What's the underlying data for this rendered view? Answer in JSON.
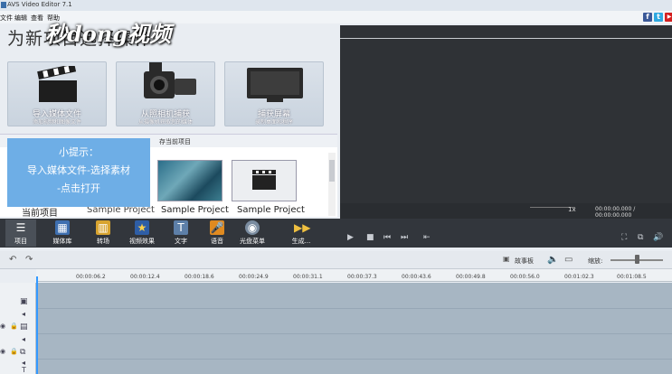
{
  "window": {
    "title": "AVS Video Editor 7.1"
  },
  "menu": [
    "文件",
    "编辑",
    "查看",
    "帮助"
  ],
  "social": {
    "facebook": "f",
    "twitter": "t",
    "youtube": "▶"
  },
  "heading": "为新项目选择操作",
  "watermark": "秒dong视频",
  "tiles": [
    {
      "label": "导入媒体文件",
      "sub": "添加视频和图像文件"
    },
    {
      "label": "从照相机捕获",
      "sub": "从摄像机获取您的媒体"
    },
    {
      "label": "捕获屏幕",
      "sub": "录制桌面和程序"
    }
  ],
  "recent": {
    "partial_tab": "存当前项目"
  },
  "thumbs": [
    {
      "label": "当前项目"
    },
    {
      "label": "Sample Project"
    },
    {
      "label": "Sample Project"
    },
    {
      "label": "Sample Project"
    }
  ],
  "tip": {
    "title": "小提示：",
    "line1": "导入媒体文件-选择素材",
    "line2": "-点击打开"
  },
  "preview_controls": {
    "speed": "1x",
    "time": "00:00:00.000 / 00:00:00.000"
  },
  "toolbar": [
    "项目",
    "媒体库",
    "转场",
    "视频效果",
    "文字",
    "语音",
    "光盘菜单",
    "生成..."
  ],
  "timeline": {
    "storyboard": "故事板",
    "zoom_label": "缩放:"
  },
  "ruler": [
    "00:00:06.2",
    "00:00:12.4",
    "00:00:18.6",
    "00:00:24.9",
    "00:00:31.1",
    "00:00:37.3",
    "00:00:43.6",
    "00:00:49.8",
    "00:00:56.0",
    "00:01:02.3",
    "00:01:08.5"
  ]
}
